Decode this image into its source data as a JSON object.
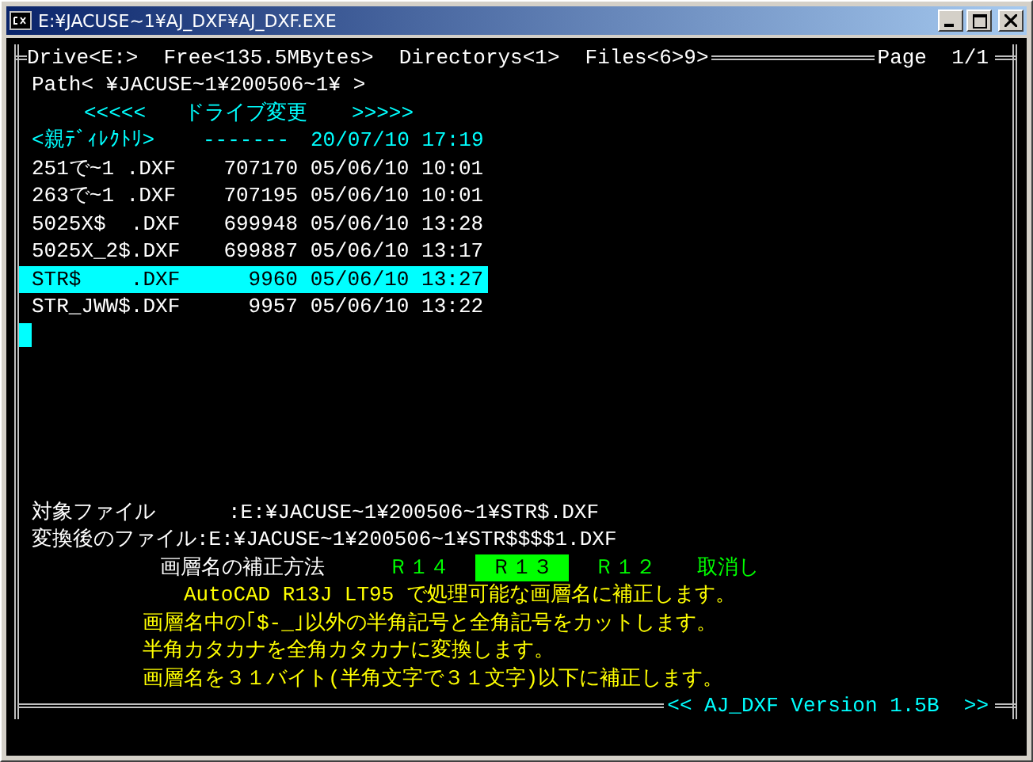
{
  "window": {
    "title": "E:¥JACUSE~1¥AJ_DXF¥AJ_DXF.EXE"
  },
  "header": {
    "drive": "Drive<E:>",
    "free": "Free<135.5MBytes>",
    "directories": "Directorys<1>",
    "files": "Files<6>9>",
    "page": "Page  1/1"
  },
  "path": "Path< ¥JACUSE~1¥200506~1¥ >",
  "drive_change": {
    "left": "<<<<<",
    "label": "ドライブ変更",
    "right": ">>>>>"
  },
  "file_list": [
    {
      "kind": "parent",
      "name": "<親ﾃﾞｨﾚｸﾄﾘ>",
      "size": "-------",
      "date": "20/07/10",
      "time": "17:19",
      "selected": false
    },
    {
      "kind": "file",
      "name": "251で~1 .DXF",
      "size": "707170",
      "date": "05/06/10",
      "time": "10:01",
      "selected": false
    },
    {
      "kind": "file",
      "name": "263で~1 .DXF",
      "size": "707195",
      "date": "05/06/10",
      "time": "10:01",
      "selected": false
    },
    {
      "kind": "file",
      "name": "5025X$  .DXF",
      "size": "699948",
      "date": "05/06/10",
      "time": "13:28",
      "selected": false
    },
    {
      "kind": "file",
      "name": "5025X_2$.DXF",
      "size": "699887",
      "date": "05/06/10",
      "time": "13:17",
      "selected": false
    },
    {
      "kind": "file",
      "name": "STR$    .DXF",
      "size": "9960",
      "date": "05/06/10",
      "time": "13:27",
      "selected": true
    },
    {
      "kind": "file",
      "name": "STR_JWW$.DXF",
      "size": "9957",
      "date": "05/06/10",
      "time": "13:22",
      "selected": false
    }
  ],
  "target_file": {
    "label": "対象ファイル",
    "value": ":E:¥JACUSE~1¥200506~1¥STR$.DXF"
  },
  "converted_file": {
    "label": "変換後のファイル",
    "value": ":E:¥JACUSE~1¥200506~1¥STR$$$$1.DXF"
  },
  "correction": {
    "label": "画層名の補正方法",
    "options": [
      {
        "label": "Ｒ１４",
        "selected": false
      },
      {
        "label": "Ｒ１３",
        "selected": true
      },
      {
        "label": "Ｒ１２",
        "selected": false
      },
      {
        "label": "取消し",
        "selected": false
      }
    ]
  },
  "descriptions": [
    "AutoCAD R13J LT95 で処理可能な画層名に補正します。",
    "画層名中の｢$-_｣以外の半角記号と全角記号をカットします。",
    "半角カタカナを全角カタカナに変換します。",
    "画層名を３１バイト(半角文字で３１文字)以下に補正します。"
  ],
  "footer": "<< AJ_DXF Version 1.5B  >>"
}
